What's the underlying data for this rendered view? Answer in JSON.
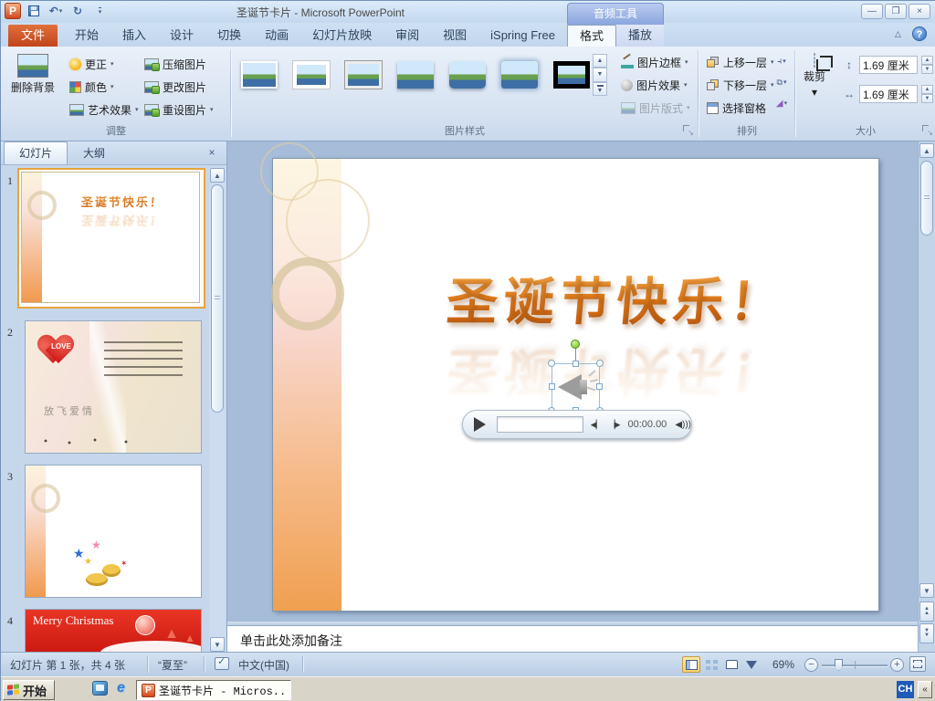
{
  "titlebar": {
    "title": "圣诞节卡片 - Microsoft PowerPoint",
    "contextual": "音频工具"
  },
  "tabs": {
    "file": "文件",
    "items": [
      "开始",
      "插入",
      "设计",
      "切换",
      "动画",
      "幻灯片放映",
      "审阅",
      "视图",
      "iSpring Free"
    ],
    "contextual": [
      {
        "label": "格式",
        "active": true
      },
      {
        "label": "播放",
        "active": false
      }
    ]
  },
  "ribbon": {
    "adjust": {
      "group": "调整",
      "remove_bg": "删除背景",
      "corrections": "更正",
      "color": "颜色",
      "artistic_effects": "艺术效果",
      "compress": "压缩图片",
      "change_picture": "更改图片",
      "reset_picture": "重设图片"
    },
    "picture_styles": {
      "group": "图片样式",
      "border": "图片边框",
      "effects": "图片效果",
      "layout": "图片版式",
      "gallery_count": 7
    },
    "arrange": {
      "group": "排列",
      "bring_forward": "上移一层",
      "send_backward": "下移一层",
      "selection_pane": "选择窗格"
    },
    "size": {
      "group": "大小",
      "crop": "裁剪",
      "height": "1.69 厘米",
      "width": "1.69 厘米"
    }
  },
  "slides_panel": {
    "tab_slides": "幻灯片",
    "tab_outline": "大纲",
    "slides": [
      {
        "num": "1"
      },
      {
        "num": "2"
      },
      {
        "num": "3"
      },
      {
        "num": "4"
      }
    ],
    "s1_title": "圣诞节快乐！",
    "s2_love": "LOVE",
    "s2_caption": "放飞爱情",
    "s4_banner": "Merry Christmas"
  },
  "canvas": {
    "title": "圣诞节快乐！",
    "audio_time": "00:00.00"
  },
  "notes": {
    "placeholder": "单击此处添加备注"
  },
  "statusbar": {
    "slide_info": "幻灯片 第 1 张，共 4 张",
    "theme": "“夏至”",
    "language": "中文(中国)",
    "zoom_level": "69%"
  },
  "taskbar": {
    "start": "开始",
    "task": "圣诞节卡片 - Micros...",
    "lang": "CH"
  },
  "colors": {
    "accent_selection": "#e8a33d",
    "file_tab": "#c2441c",
    "contextual_header": "#8aa6de",
    "title_orange": "#e07818",
    "taskbar_lang_bg": "#1e5bb8",
    "workspace": "#a6bcd8"
  }
}
